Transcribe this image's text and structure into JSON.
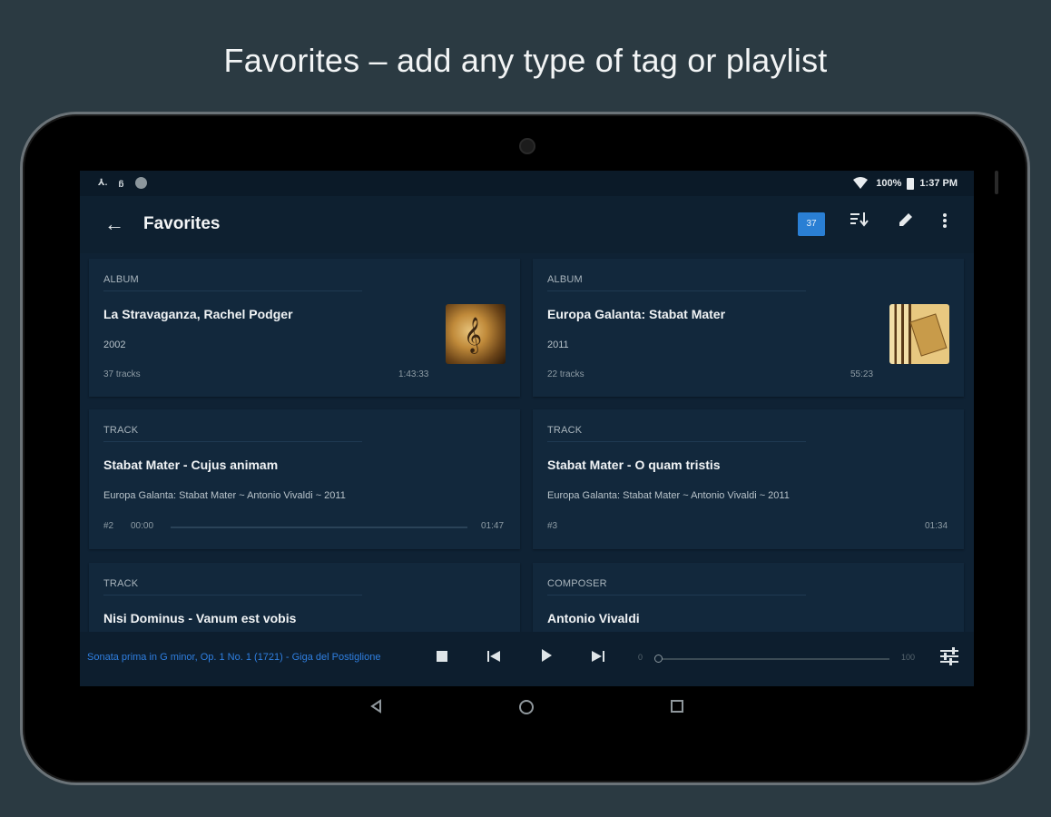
{
  "headline": "Favorites – add any type of tag or playlist",
  "statusbar": {
    "left_icons": [
      "download-icon",
      "sync-icon",
      "circle-icon"
    ],
    "left_text": [
      "⅄.",
      "ᵷ"
    ],
    "battery": "100%",
    "time": "1:37 PM"
  },
  "appbar": {
    "title": "Favorites",
    "count_badge": "37",
    "icons": [
      "back-arrow-icon",
      "sort-icon",
      "edit-icon",
      "more-vert-icon"
    ]
  },
  "cards": [
    {
      "kind": "ALBUM",
      "name": "La Stravaganza, Rachel Podger",
      "sub": "2002",
      "meta_left": "37 tracks",
      "meta_right": "1:43:33"
    },
    {
      "kind": "ALBUM",
      "name": "Europa Galanta: Stabat Mater",
      "sub": "2011",
      "meta_left": "22 tracks",
      "meta_right": "55:23"
    },
    {
      "kind": "TRACK",
      "name": "Stabat Mater - Cujus animam",
      "sub": "Europa Galanta: Stabat Mater ~ Antonio Vivaldi ~ 2011",
      "meta_left": "#2",
      "meta_pos": "00:00",
      "meta_right": "01:47"
    },
    {
      "kind": "TRACK",
      "name": "Stabat Mater - O quam tristis",
      "sub": "Europa Galanta: Stabat Mater ~ Antonio Vivaldi ~ 2011",
      "meta_left": "#3",
      "meta_right": "01:34"
    },
    {
      "kind": "TRACK",
      "name": "Nisi Dominus - Vanum est vobis"
    },
    {
      "kind": "COMPOSER",
      "name": "Antonio Vivaldi"
    }
  ],
  "player": {
    "now_playing": "Sonata prima in G minor, Op. 1 No. 1 (1721) - Giga del Postiglione",
    "volume_min": "0",
    "volume_max": "100",
    "volume_level": 0
  },
  "colors": {
    "accent": "#2a7fd4",
    "now_playing": "#2f7fe0",
    "screen_bg": "#0f2234",
    "card_bg": "#12283c"
  }
}
